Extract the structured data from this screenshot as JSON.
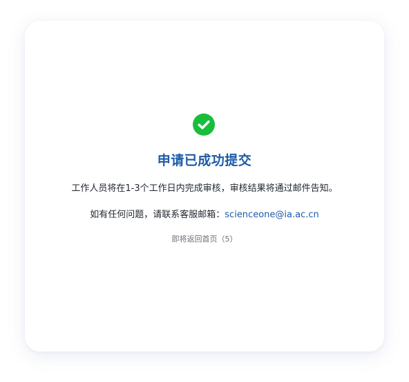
{
  "dialog": {
    "icon": "check-circle-icon",
    "title": "申请已成功提交",
    "message": "工作人员将在1-3个工作日内完成审核，审核结果将通过邮件告知。",
    "contact_prefix": "如有任何问题，请联系客服邮箱：",
    "contact_email": "scienceone@ia.ac.cn",
    "redirect_notice": "即将返回首页（5）"
  },
  "colors": {
    "accent": "#1d5aa8",
    "success": "#19bd3c",
    "text": "#222831",
    "muted": "#6b7077"
  }
}
